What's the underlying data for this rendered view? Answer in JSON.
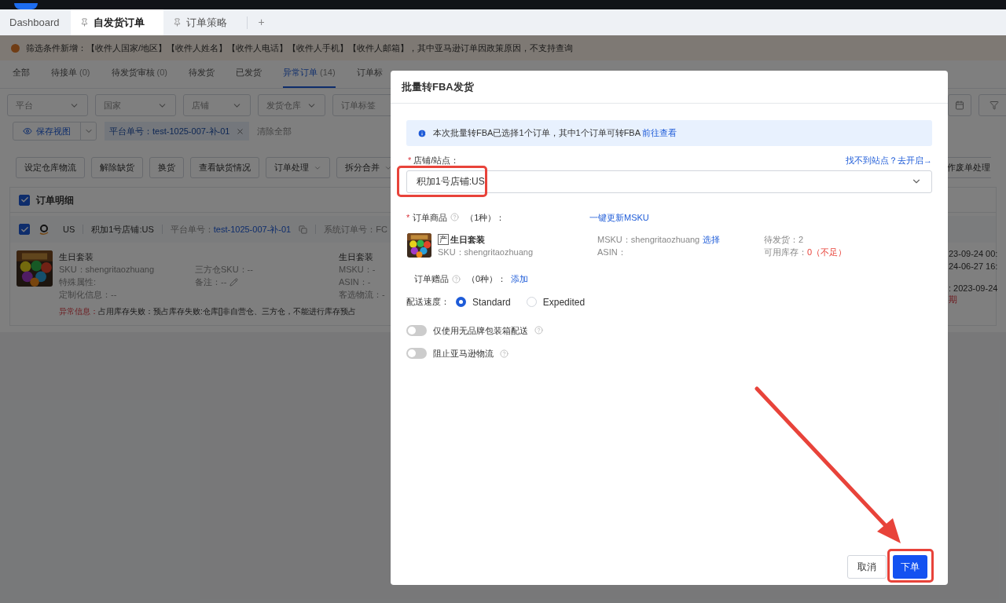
{
  "page_tabs": [
    {
      "label": "Dashboard",
      "kind": "plain",
      "selected": false
    },
    {
      "label": "自发货订单",
      "kind": "pinned",
      "selected": true
    },
    {
      "label": "订单策略",
      "kind": "pinned",
      "selected": false
    }
  ],
  "add_tab": "+",
  "notice": "筛选条件新增：【收件人国家/地区】【收件人姓名】【收件人电话】【收件人手机】【收件人邮箱】，其中亚马逊订单因政策原因，不支持查询",
  "status_tabs": [
    {
      "label": "全部",
      "selected": false
    },
    {
      "label": "待接单",
      "count": "(0)",
      "selected": false
    },
    {
      "label": "待发货审核",
      "count": "(0)",
      "selected": false
    },
    {
      "label": "待发货",
      "selected": false
    },
    {
      "label": "已发货",
      "selected": false
    },
    {
      "label": "异常订单",
      "count": "(14)",
      "selected": true
    },
    {
      "label": "订单标",
      "selected": false
    }
  ],
  "filters": [
    "平台",
    "国家",
    "店铺",
    "发货仓库",
    "订单标签"
  ],
  "view_button": "保存视图",
  "chip": "平台单号：test-1025-007-补-01",
  "clear_all": "清除全部",
  "actions": [
    {
      "label": "设定仓库物流",
      "dropdown": false
    },
    {
      "label": "解除缺货",
      "dropdown": false
    },
    {
      "label": "换货",
      "dropdown": false
    },
    {
      "label": "查看缺货情况",
      "dropdown": false
    },
    {
      "label": "订单处理",
      "dropdown": true
    },
    {
      "label": "拆分合并",
      "dropdown": true
    }
  ],
  "right_action": "作废单处理",
  "table": {
    "header": {
      "label": "订单明细",
      "checked": true
    },
    "order": {
      "checked": true,
      "site": "US",
      "store": "积加1号店铺:US",
      "platform_no_label": "平台单号：",
      "platform_no": "test-1025-007-补-01",
      "system_no": "系统订单号：FC",
      "product_name": "生日套装",
      "col1": [
        "SKU：shengritaozhuang",
        "特殊属性:",
        "定制化信息：--"
      ],
      "col2": [
        "三方仓SKU：--",
        "备注：--"
      ],
      "col3": [
        "生日套装",
        "MSKU：-",
        "ASIN：-",
        "客选物流：-"
      ],
      "error_label": "异常信息：",
      "error": "占用库存失败：预占库存失败:仓库[]非自营仓、三方仓，不能进行库存预占",
      "dates": [
        "23-09-24 00:",
        "24-06-27 16:",
        ":  2023-09-24"
      ],
      "date_note": "期"
    }
  },
  "modal": {
    "title": "批量转FBA发货",
    "alert": "本次批量转FBA已选择1个订单，其中1个订单可转FBA",
    "alert_link": "前往查看",
    "store_label": "店铺/站点：",
    "store_mark": "*",
    "store_link": "找不到站点？去开启→",
    "store_value": "积加1号店铺:US",
    "store_highlighted": true,
    "items_label": "订单商品",
    "items_mark": "*",
    "items_count": "（1种）：",
    "update_link": "一键更新MSKU",
    "item": {
      "tag": "产",
      "name": "生日套装",
      "sku": "SKU：shengritaozhuang",
      "msku": "MSKU：shengritaozhuang",
      "msku_link": "选择",
      "asin": "ASIN：",
      "pending": "待发货：2",
      "stock_label": "可用库存：",
      "stock_value": "0（不足）"
    },
    "gifts_label": "订单赠品",
    "gifts_count": "（0种）：",
    "gifts_link": "添加",
    "speed_label": "配送速度：",
    "speeds": [
      {
        "label": "Standard",
        "selected": true
      },
      {
        "label": "Expedited",
        "selected": false
      }
    ],
    "toggles": [
      {
        "label": "仅使用无品牌包装箱配送",
        "on": false
      },
      {
        "label": "阻止亚马逊物流",
        "on": false
      }
    ],
    "buttons": [
      {
        "label": "取消",
        "kind": "secondary",
        "highlighted": false
      },
      {
        "label": "下单",
        "kind": "primary",
        "highlighted": true
      }
    ]
  }
}
